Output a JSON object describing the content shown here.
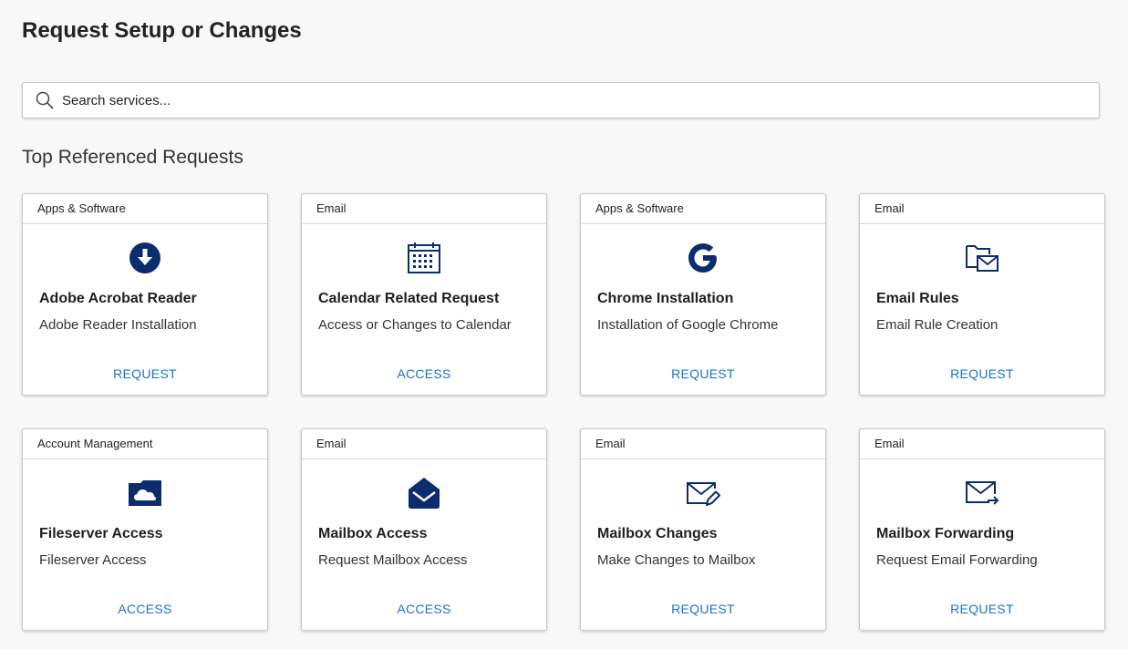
{
  "header": {
    "title": "Request Setup or Changes"
  },
  "search": {
    "placeholder": "Search services...",
    "icon": "search-icon"
  },
  "section": {
    "title": "Top Referenced Requests"
  },
  "colors": {
    "icon": "#0b2d6e",
    "action": "#1a73c8"
  },
  "cards": [
    {
      "category": "Apps & Software",
      "title": "Adobe Acrobat Reader",
      "description": "Adobe Reader Installation",
      "action": "REQUEST",
      "icon": "download-icon"
    },
    {
      "category": "Email",
      "title": "Calendar Related Request",
      "description": "Access or Changes to Calendar",
      "action": "ACCESS",
      "icon": "calendar-icon"
    },
    {
      "category": "Apps & Software",
      "title": "Chrome Installation",
      "description": "Installation of Google Chrome",
      "action": "REQUEST",
      "icon": "google-icon"
    },
    {
      "category": "Email",
      "title": "Email Rules",
      "description": "Email Rule Creation",
      "action": "REQUEST",
      "icon": "folder-mail-icon"
    },
    {
      "category": "Account Management",
      "title": "Fileserver Access",
      "description": "Fileserver Access",
      "action": "ACCESS",
      "icon": "cloud-folder-icon"
    },
    {
      "category": "Email",
      "title": "Mailbox Access",
      "description": "Request Mailbox Access",
      "action": "ACCESS",
      "icon": "open-envelope-icon"
    },
    {
      "category": "Email",
      "title": "Mailbox Changes",
      "description": "Make Changes to Mailbox",
      "action": "REQUEST",
      "icon": "envelope-edit-icon"
    },
    {
      "category": "Email",
      "title": "Mailbox Forwarding",
      "description": "Request Email Forwarding",
      "action": "REQUEST",
      "icon": "envelope-forward-icon"
    }
  ]
}
